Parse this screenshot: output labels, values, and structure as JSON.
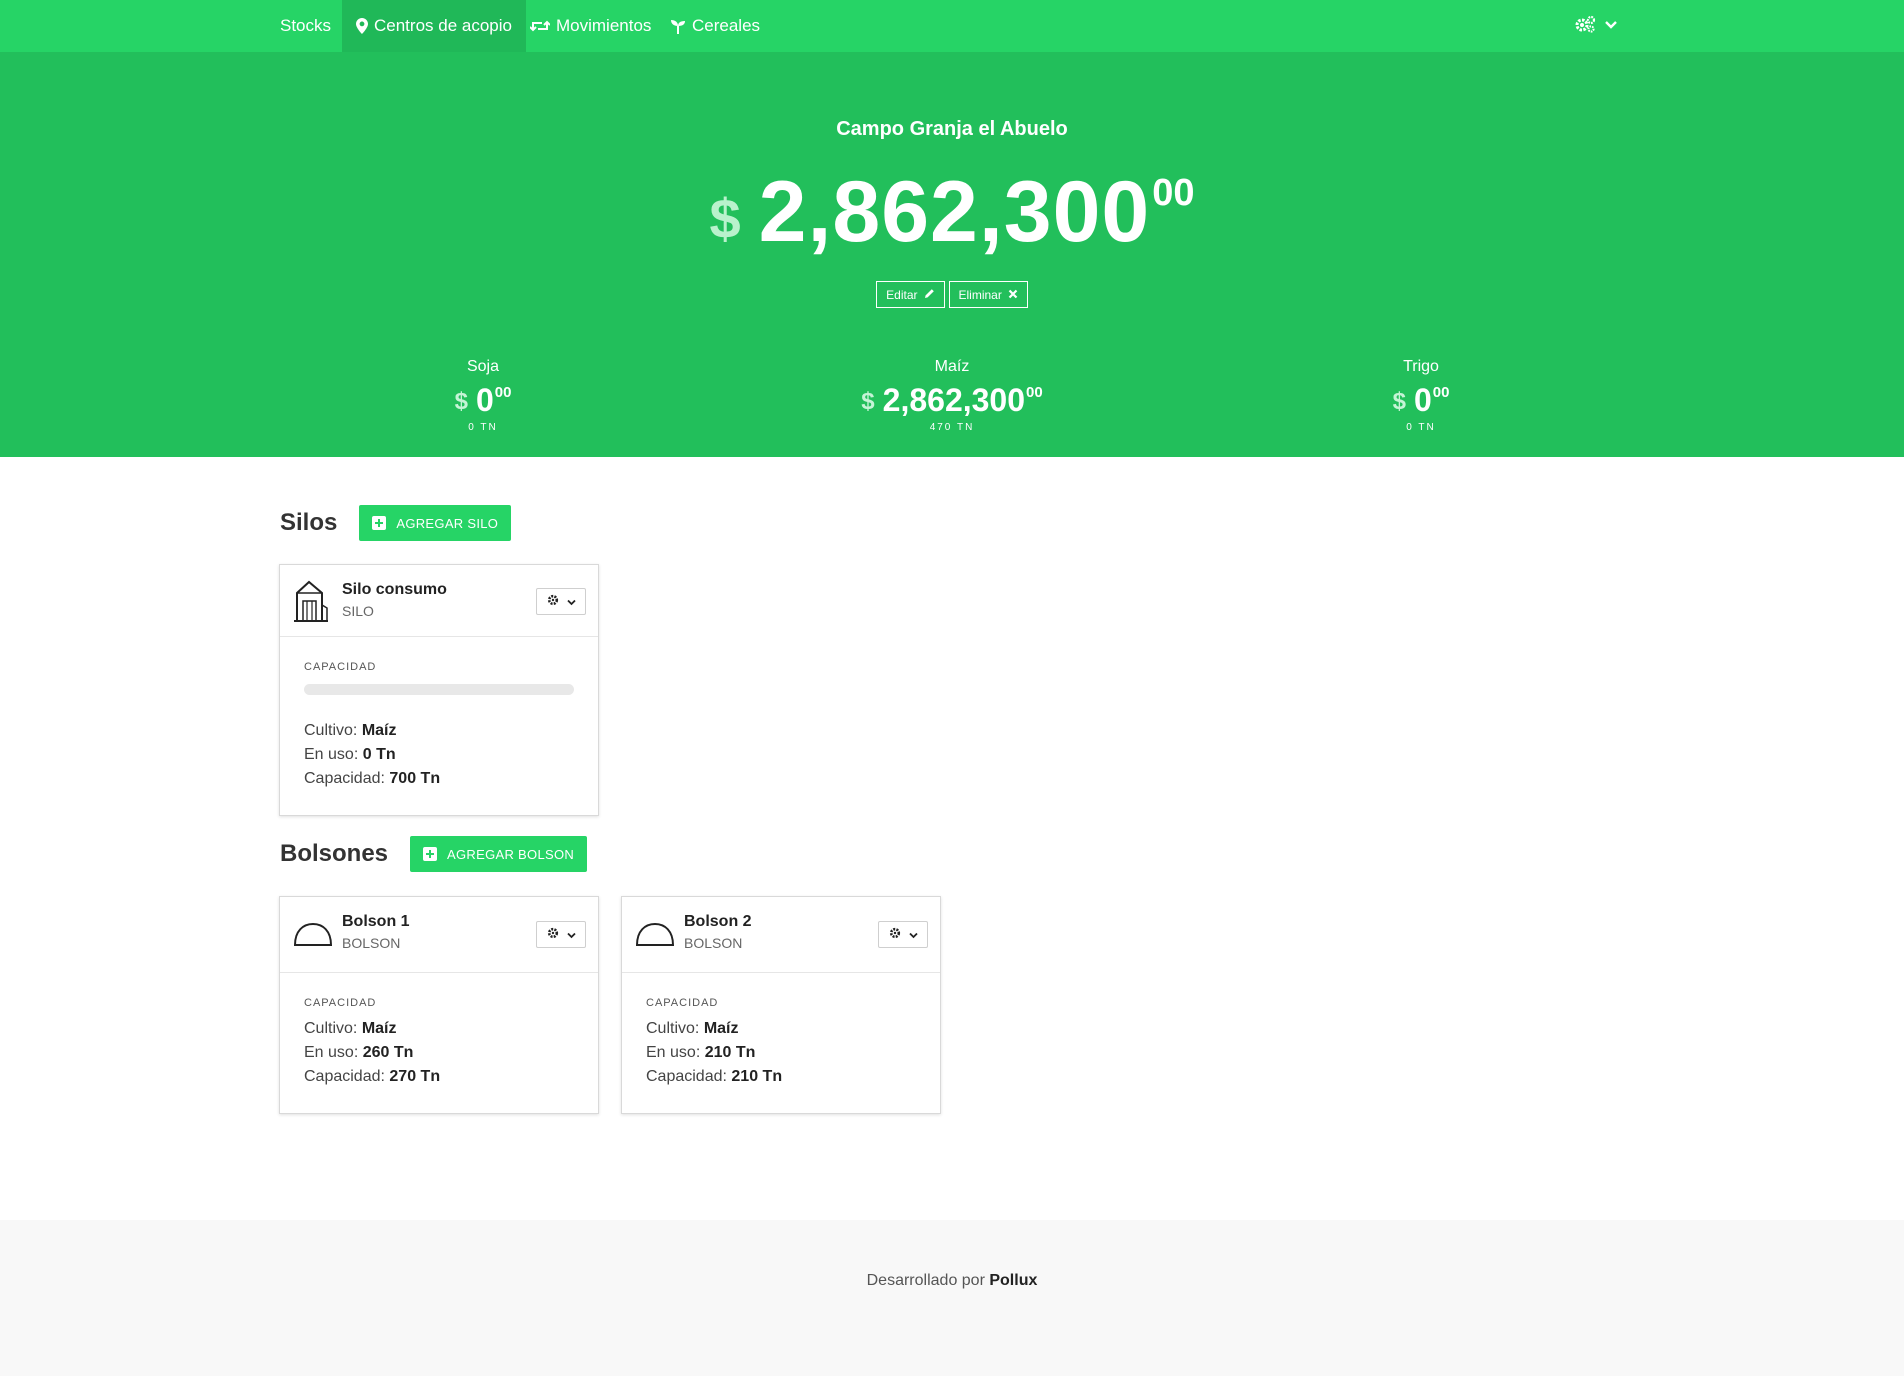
{
  "nav": {
    "items": [
      {
        "label": "Stocks",
        "icon": ""
      },
      {
        "label": "Centros de acopio",
        "icon": "map-marker-icon"
      },
      {
        "label": "Movimientos",
        "icon": "retweet-icon"
      },
      {
        "label": "Cereales",
        "icon": "seedling-icon"
      }
    ],
    "active_index": 1,
    "settings_icon": "cogs-icon"
  },
  "hero": {
    "title": "Campo Granja el Abuelo",
    "currency": "$",
    "amount_int": "2,862,300",
    "amount_dec": "00",
    "edit_label": "Editar",
    "delete_label": "Eliminar"
  },
  "crops": [
    {
      "name": "Soja",
      "currency": "$",
      "int": "0",
      "dec": "00",
      "tn": "0 TN"
    },
    {
      "name": "Maíz",
      "currency": "$",
      "int": "2,862,300",
      "dec": "00",
      "tn": "470 TN"
    },
    {
      "name": "Trigo",
      "currency": "$",
      "int": "0",
      "dec": "00",
      "tn": "0 TN"
    }
  ],
  "silos": {
    "title": "Silos",
    "add_label": "AGREGAR SILO",
    "items": [
      {
        "name": "Silo consumo",
        "type": "SILO",
        "icon": "silo-icon",
        "capacity_label": "CAPACIDAD",
        "fill_fraction": 0,
        "cultivo_label": "Cultivo:",
        "cultivo": "Maíz",
        "uso_label": "En uso:",
        "uso": "0 Tn",
        "cap_label": "Capacidad:",
        "cap": "700 Tn"
      }
    ]
  },
  "bolsones": {
    "title": "Bolsones",
    "add_label": "AGREGAR BOLSON",
    "items": [
      {
        "name": "Bolson 1",
        "type": "BOLSON",
        "icon": "bolson-icon",
        "capacity_label": "CAPACIDAD",
        "cultivo_label": "Cultivo:",
        "cultivo": "Maíz",
        "uso_label": "En uso:",
        "uso": "260 Tn",
        "cap_label": "Capacidad:",
        "cap": "270 Tn"
      },
      {
        "name": "Bolson 2",
        "type": "BOLSON",
        "icon": "bolson-icon",
        "capacity_label": "CAPACIDAD",
        "cultivo_label": "Cultivo:",
        "cultivo": "Maíz",
        "uso_label": "En uso:",
        "uso": "210 Tn",
        "cap_label": "Capacidad:",
        "cap": "210 Tn"
      }
    ]
  },
  "footer": {
    "prefix": "Desarrollado por",
    "brand": "Pollux"
  },
  "colors": {
    "nav": "#26d466",
    "hero": "#22bf5b",
    "accent": "#26d466"
  }
}
